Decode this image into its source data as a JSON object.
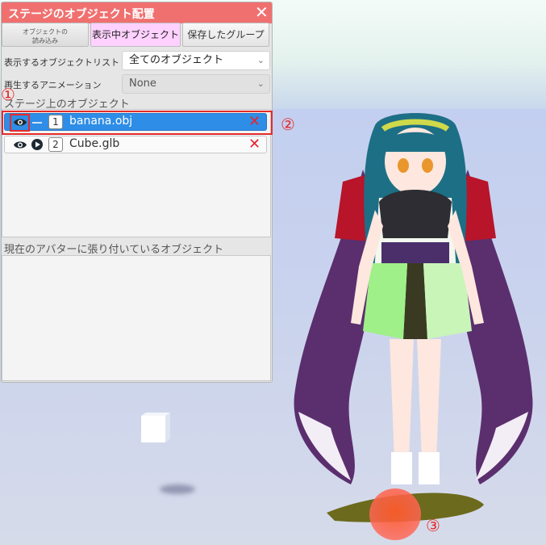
{
  "window": {
    "title": "ステージのオブジェクト配置",
    "close_glyph": "✕"
  },
  "tabs": [
    {
      "label": "オブジェクトの読み込み",
      "line1": "オブジェクトの",
      "line2": "読み込み",
      "active": false
    },
    {
      "label": "表示中オブジェクト",
      "active": true
    },
    {
      "label": "保存したグループ",
      "active": false
    }
  ],
  "filters": {
    "object_list_label": "表示するオブジェクトリスト",
    "object_list_value": "全てのオブジェクト",
    "animation_label": "再生するアニメーション",
    "animation_value": "None"
  },
  "stage_objects": {
    "heading": "ステージ上のオブジェクト",
    "items": [
      {
        "index": "1",
        "name": "banana.obj",
        "selected": true,
        "visible_icon": "eye-icon",
        "delete_icon": "close-icon"
      },
      {
        "index": "2",
        "name": "Cube.glb",
        "selected": false,
        "visible_icon": "eye-icon",
        "play_icon": "play-icon",
        "delete_icon": "close-icon"
      }
    ]
  },
  "avatar_objects": {
    "heading": "現在のアバターに張り付いているオブジェクト"
  },
  "annotations": {
    "one": "①",
    "two": "②",
    "three": "③"
  },
  "colors": {
    "titlebar": "#f07070",
    "active_tab": "#ffd1ff",
    "selected_row": "#2e8de6",
    "delete": "#e8242f",
    "annotation": "#e52b2b"
  }
}
